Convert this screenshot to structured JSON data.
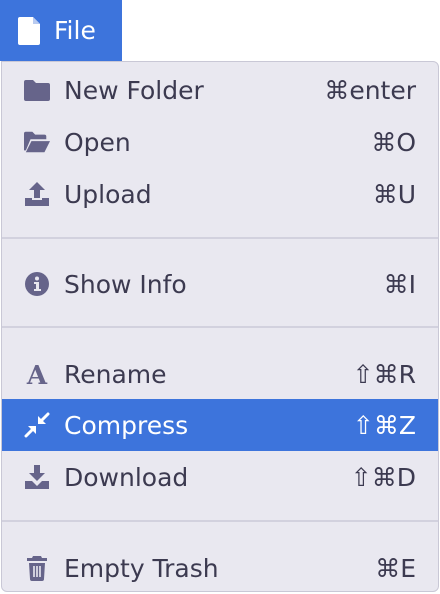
{
  "menubar": {
    "file_label": "File"
  },
  "menu": {
    "items": [
      {
        "label": "New Folder",
        "shortcut": "⌘enter",
        "icon": "folder-icon"
      },
      {
        "label": "Open",
        "shortcut": "⌘O",
        "icon": "folder-open-icon"
      },
      {
        "label": "Upload",
        "shortcut": "⌘U",
        "icon": "upload-icon"
      },
      {
        "label": "Show Info",
        "shortcut": "⌘I",
        "icon": "info-icon"
      },
      {
        "label": "Rename",
        "shortcut": "⇧⌘R",
        "icon": "font-icon"
      },
      {
        "label": "Compress",
        "shortcut": "⇧⌘Z",
        "icon": "compress-icon",
        "selected": true
      },
      {
        "label": "Download",
        "shortcut": "⇧⌘D",
        "icon": "download-icon"
      },
      {
        "label": "Empty Trash",
        "shortcut": "⌘E",
        "icon": "trash-icon"
      }
    ]
  },
  "colors": {
    "accent": "#3d74dc",
    "menu_bg": "#e9e8f0",
    "icon": "#66648a",
    "text": "#3c3a50"
  }
}
